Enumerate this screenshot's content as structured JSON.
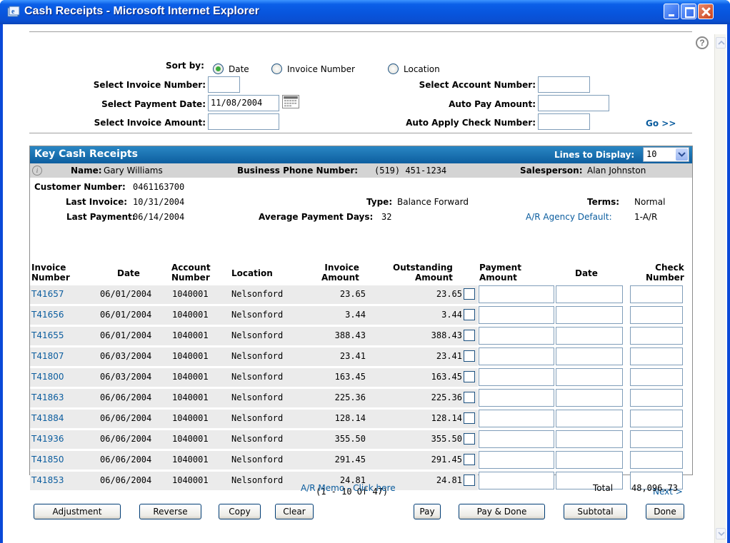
{
  "window": {
    "title": "Cash Receipts - Microsoft Internet Explorer"
  },
  "filters": {
    "sort_by_label": "Sort by:",
    "sort_options": [
      {
        "label": "Date",
        "selected": true
      },
      {
        "label": "Invoice Number",
        "selected": false
      },
      {
        "label": "Location",
        "selected": false
      }
    ],
    "invoice_number_label": "Select Invoice Number:",
    "invoice_number_value": "",
    "payment_date_label": "Select Payment Date:",
    "payment_date_value": "11/08/2004",
    "invoice_amount_label": "Select Invoice Amount:",
    "invoice_amount_value": "",
    "account_number_label": "Select Account Number:",
    "account_number_value": "",
    "auto_pay_label": "Auto Pay Amount:",
    "auto_pay_value": "",
    "auto_apply_label": "Auto Apply Check Number:",
    "auto_apply_value": "",
    "go_label": "Go >>"
  },
  "panel": {
    "title": "Key Cash Receipts",
    "lines_label": "Lines to Display:",
    "lines_value": "10"
  },
  "customer": {
    "name_label": "Name:",
    "name": "Gary Williams",
    "phone_label": "Business Phone Number:",
    "phone": "(519) 451-1234",
    "salesperson_label": "Salesperson:",
    "salesperson": "Alan Johnston",
    "customer_number_label": "Customer Number:",
    "customer_number": "0461163700",
    "last_invoice_label": "Last Invoice:",
    "last_invoice": "10/31/2004",
    "type_label": "Type:",
    "type": "Balance Forward",
    "terms_label": "Terms:",
    "terms": "Normal",
    "last_payment_label": "Last Payment:",
    "last_payment": "06/14/2004",
    "avg_days_label": "Average Payment Days:",
    "avg_days": "32",
    "agency_label": "A/R Agency Default:",
    "agency": "1-A/R"
  },
  "table": {
    "headers": {
      "invoice_number_1": "Invoice",
      "invoice_number_2": "Number",
      "date": "Date",
      "account_1": "Account",
      "account_2": "Number",
      "location": "Location",
      "invoice_amount_1": "Invoice",
      "invoice_amount_2": "Amount",
      "outstanding_1": "Outstanding",
      "outstanding_2": "Amount",
      "payment_1": "Payment",
      "payment_2": "Amount",
      "pay_date": "Date",
      "check_1": "Check",
      "check_2": "Number"
    },
    "rows": [
      {
        "invoice": "T41657",
        "date": "06/01/2004",
        "account": "1040001",
        "location": "Nelsonford",
        "amount": "23.65",
        "outstanding": "23.65"
      },
      {
        "invoice": "T41656",
        "date": "06/01/2004",
        "account": "1040001",
        "location": "Nelsonford",
        "amount": "3.44",
        "outstanding": "3.44"
      },
      {
        "invoice": "T41655",
        "date": "06/01/2004",
        "account": "1040001",
        "location": "Nelsonford",
        "amount": "388.43",
        "outstanding": "388.43"
      },
      {
        "invoice": "T41807",
        "date": "06/03/2004",
        "account": "1040001",
        "location": "Nelsonford",
        "amount": "23.41",
        "outstanding": "23.41"
      },
      {
        "invoice": "T41800",
        "date": "06/03/2004",
        "account": "1040001",
        "location": "Nelsonford",
        "amount": "163.45",
        "outstanding": "163.45"
      },
      {
        "invoice": "T41863",
        "date": "06/06/2004",
        "account": "1040001",
        "location": "Nelsonford",
        "amount": "225.36",
        "outstanding": "225.36"
      },
      {
        "invoice": "T41884",
        "date": "06/06/2004",
        "account": "1040001",
        "location": "Nelsonford",
        "amount": "128.14",
        "outstanding": "128.14"
      },
      {
        "invoice": "T41936",
        "date": "06/06/2004",
        "account": "1040001",
        "location": "Nelsonford",
        "amount": "355.50",
        "outstanding": "355.50"
      },
      {
        "invoice": "T41850",
        "date": "06/06/2004",
        "account": "1040001",
        "location": "Nelsonford",
        "amount": "291.45",
        "outstanding": "291.45"
      },
      {
        "invoice": "T41853",
        "date": "06/06/2004",
        "account": "1040001",
        "location": "Nelsonford",
        "amount": "24.81",
        "outstanding": "24.81"
      }
    ],
    "pager": "(1 - 10 Of 47)",
    "next_label": "Next >"
  },
  "footer": {
    "memo_link": "A/R Memo - Click here",
    "total_label": "Total",
    "total_value": "48,096.73",
    "buttons": {
      "adjustment": "Adjustment",
      "reverse": "Reverse",
      "copy": "Copy",
      "clear": "Clear",
      "pay": "Pay",
      "pay_done": "Pay & Done",
      "subtotal": "Subtotal",
      "done": "Done"
    }
  }
}
